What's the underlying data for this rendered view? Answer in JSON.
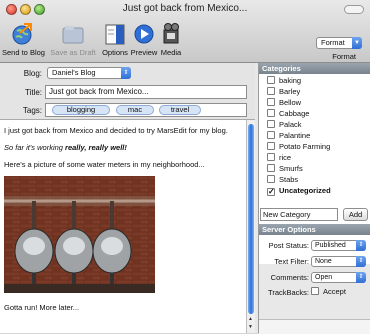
{
  "window": {
    "title": "Just got back from Mexico..."
  },
  "toolbar": {
    "send_to_blog": "Send to Blog",
    "save_as_draft": "Save as Draft",
    "options": "Options",
    "preview": "Preview",
    "media": "Media",
    "format_value": "Format",
    "format_label": "Format"
  },
  "post": {
    "blog_label": "Blog:",
    "blog_value": "Daniel's Blog",
    "title_label": "Title:",
    "title_value": "Just got back from Mexico...",
    "tags_label": "Tags:",
    "tags": [
      "blogging",
      "mac",
      "travel"
    ]
  },
  "body": {
    "p1": "I just got back from Mexico and decided to try MarsEdit for my blog.",
    "p2_prefix": "So far it's working ",
    "p2_em": "really, really well!",
    "p3": "Here's a picture of some water meters in my neighborhood...",
    "p4": "Gotta run! More later..."
  },
  "categories": {
    "header": "Categories",
    "items": [
      {
        "label": "baking",
        "checked": false
      },
      {
        "label": "Barley",
        "checked": false
      },
      {
        "label": "Bellow",
        "checked": false
      },
      {
        "label": "Cabbage",
        "checked": false
      },
      {
        "label": "Palack",
        "checked": false
      },
      {
        "label": "Palantine",
        "checked": false
      },
      {
        "label": "Potato Farming",
        "checked": false
      },
      {
        "label": "rice",
        "checked": false
      },
      {
        "label": "Smurfs",
        "checked": false
      },
      {
        "label": "Stabs",
        "checked": false
      },
      {
        "label": "Uncategorized",
        "checked": true
      }
    ],
    "new_placeholder": "New Category",
    "add_label": "Add"
  },
  "server_options": {
    "header": "Server Options",
    "post_status_label": "Post Status:",
    "post_status_value": "Published",
    "text_filter_label": "Text Filter:",
    "text_filter_value": "None",
    "comments_label": "Comments:",
    "comments_value": "Open",
    "trackbacks_label": "TrackBacks:",
    "trackbacks_value": "Accept"
  }
}
